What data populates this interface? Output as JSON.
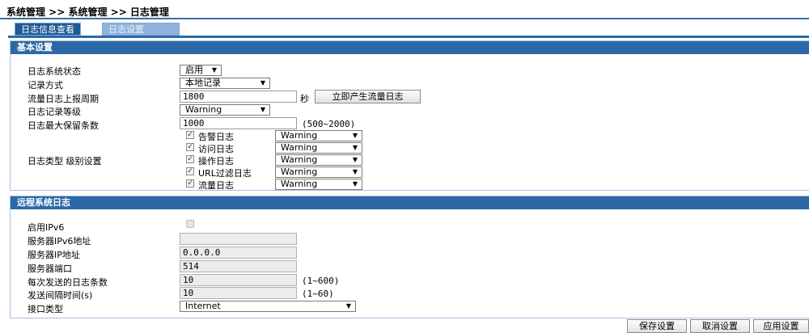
{
  "breadcrumb": "系统管理 >> 系统管理 >> 日志管理",
  "tabs": [
    {
      "label": "日志信息查看",
      "active": true
    },
    {
      "label": "日志设置",
      "active": false
    }
  ],
  "basic": {
    "title": "基本设置",
    "status_label": "日志系统状态",
    "status_value": "启用",
    "record_label": "记录方式",
    "record_value": "本地记录",
    "period_label": "流量日志上报周期",
    "period_value": "1800",
    "period_unit": "秒",
    "generate_button": "立即产生流量日志",
    "level_label": "日志记录等级",
    "level_value": "Warning",
    "max_label": "日志最大保留条数",
    "max_value": "1000",
    "max_hint": "(500~2000)",
    "types_label": "日志类型  级别设置",
    "types": [
      {
        "name": "告警日志",
        "checked": true,
        "level": "Warning"
      },
      {
        "name": "访问日志",
        "checked": true,
        "level": "Warning"
      },
      {
        "name": "操作日志",
        "checked": true,
        "level": "Warning"
      },
      {
        "name": "URL过滤日志",
        "checked": true,
        "level": "Warning"
      },
      {
        "name": "流量日志",
        "checked": true,
        "level": "Warning"
      }
    ]
  },
  "remote": {
    "title": "远程系统日志",
    "ipv6_label": "启用IPv6",
    "ipv6_server_label": "服务器IPv6地址",
    "ipv6_server_value": "",
    "ip_label": "服务器IP地址",
    "ip_value": "0.0.0.0",
    "port_label": "服务器端口",
    "port_value": "514",
    "count_label": "每次发送的日志条数",
    "count_value": "10",
    "count_hint": "(1~600)",
    "interval_label": "发送间隔时间(s)",
    "interval_value": "10",
    "interval_hint": "(1~60)",
    "iface_label": "接口类型",
    "iface_value": "Internet"
  },
  "footer": {
    "save": "保存设置",
    "cancel": "取消设置",
    "apply": "应用设置"
  }
}
